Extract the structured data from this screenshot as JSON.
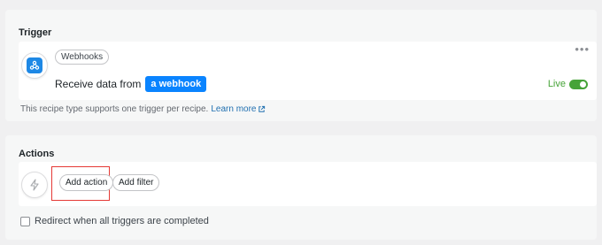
{
  "trigger": {
    "section_title": "Trigger",
    "integration_name": "Webhooks",
    "sentence_prefix": "Receive data from",
    "token_label": "a webhook",
    "status_label": "Live",
    "status_on": true,
    "help_text": "This recipe type supports one trigger per recipe.",
    "learn_more_label": "Learn more",
    "icons": {
      "app": "webhook-icon",
      "menu": "more-dots-icon",
      "external": "external-link-icon"
    }
  },
  "actions": {
    "section_title": "Actions",
    "add_action_label": "Add action",
    "add_filter_label": "Add filter",
    "redirect_label": "Redirect when all triggers are completed",
    "redirect_checked": false,
    "icons": {
      "placeholder": "lightning-bolt-icon"
    }
  },
  "colors": {
    "accent": "#0a84ff",
    "live_green": "#46a338",
    "highlight": "#e53935"
  }
}
